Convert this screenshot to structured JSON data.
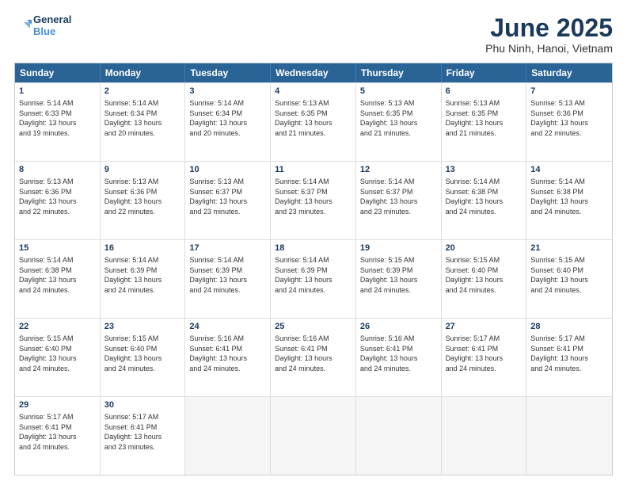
{
  "logo": {
    "line1": "General",
    "line2": "Blue"
  },
  "title": "June 2025",
  "location": "Phu Ninh, Hanoi, Vietnam",
  "headers": [
    "Sunday",
    "Monday",
    "Tuesday",
    "Wednesday",
    "Thursday",
    "Friday",
    "Saturday"
  ],
  "rows": [
    [
      {
        "day": "",
        "info": ""
      },
      {
        "day": "2",
        "info": "Sunrise: 5:14 AM\nSunset: 6:34 PM\nDaylight: 13 hours\nand 20 minutes."
      },
      {
        "day": "3",
        "info": "Sunrise: 5:14 AM\nSunset: 6:34 PM\nDaylight: 13 hours\nand 20 minutes."
      },
      {
        "day": "4",
        "info": "Sunrise: 5:13 AM\nSunset: 6:35 PM\nDaylight: 13 hours\nand 21 minutes."
      },
      {
        "day": "5",
        "info": "Sunrise: 5:13 AM\nSunset: 6:35 PM\nDaylight: 13 hours\nand 21 minutes."
      },
      {
        "day": "6",
        "info": "Sunrise: 5:13 AM\nSunset: 6:35 PM\nDaylight: 13 hours\nand 21 minutes."
      },
      {
        "day": "7",
        "info": "Sunrise: 5:13 AM\nSunset: 6:36 PM\nDaylight: 13 hours\nand 22 minutes."
      }
    ],
    [
      {
        "day": "1",
        "info": "Sunrise: 5:14 AM\nSunset: 6:33 PM\nDaylight: 13 hours\nand 19 minutes."
      },
      null,
      null,
      null,
      null,
      null,
      null
    ],
    [
      {
        "day": "8",
        "info": "Sunrise: 5:13 AM\nSunset: 6:36 PM\nDaylight: 13 hours\nand 22 minutes."
      },
      {
        "day": "9",
        "info": "Sunrise: 5:13 AM\nSunset: 6:36 PM\nDaylight: 13 hours\nand 22 minutes."
      },
      {
        "day": "10",
        "info": "Sunrise: 5:13 AM\nSunset: 6:37 PM\nDaylight: 13 hours\nand 23 minutes."
      },
      {
        "day": "11",
        "info": "Sunrise: 5:14 AM\nSunset: 6:37 PM\nDaylight: 13 hours\nand 23 minutes."
      },
      {
        "day": "12",
        "info": "Sunrise: 5:14 AM\nSunset: 6:37 PM\nDaylight: 13 hours\nand 23 minutes."
      },
      {
        "day": "13",
        "info": "Sunrise: 5:14 AM\nSunset: 6:38 PM\nDaylight: 13 hours\nand 24 minutes."
      },
      {
        "day": "14",
        "info": "Sunrise: 5:14 AM\nSunset: 6:38 PM\nDaylight: 13 hours\nand 24 minutes."
      }
    ],
    [
      {
        "day": "15",
        "info": "Sunrise: 5:14 AM\nSunset: 6:38 PM\nDaylight: 13 hours\nand 24 minutes."
      },
      {
        "day": "16",
        "info": "Sunrise: 5:14 AM\nSunset: 6:39 PM\nDaylight: 13 hours\nand 24 minutes."
      },
      {
        "day": "17",
        "info": "Sunrise: 5:14 AM\nSunset: 6:39 PM\nDaylight: 13 hours\nand 24 minutes."
      },
      {
        "day": "18",
        "info": "Sunrise: 5:14 AM\nSunset: 6:39 PM\nDaylight: 13 hours\nand 24 minutes."
      },
      {
        "day": "19",
        "info": "Sunrise: 5:15 AM\nSunset: 6:39 PM\nDaylight: 13 hours\nand 24 minutes."
      },
      {
        "day": "20",
        "info": "Sunrise: 5:15 AM\nSunset: 6:40 PM\nDaylight: 13 hours\nand 24 minutes."
      },
      {
        "day": "21",
        "info": "Sunrise: 5:15 AM\nSunset: 6:40 PM\nDaylight: 13 hours\nand 24 minutes."
      }
    ],
    [
      {
        "day": "22",
        "info": "Sunrise: 5:15 AM\nSunset: 6:40 PM\nDaylight: 13 hours\nand 24 minutes."
      },
      {
        "day": "23",
        "info": "Sunrise: 5:15 AM\nSunset: 6:40 PM\nDaylight: 13 hours\nand 24 minutes."
      },
      {
        "day": "24",
        "info": "Sunrise: 5:16 AM\nSunset: 6:41 PM\nDaylight: 13 hours\nand 24 minutes."
      },
      {
        "day": "25",
        "info": "Sunrise: 5:16 AM\nSunset: 6:41 PM\nDaylight: 13 hours\nand 24 minutes."
      },
      {
        "day": "26",
        "info": "Sunrise: 5:16 AM\nSunset: 6:41 PM\nDaylight: 13 hours\nand 24 minutes."
      },
      {
        "day": "27",
        "info": "Sunrise: 5:17 AM\nSunset: 6:41 PM\nDaylight: 13 hours\nand 24 minutes."
      },
      {
        "day": "28",
        "info": "Sunrise: 5:17 AM\nSunset: 6:41 PM\nDaylight: 13 hours\nand 24 minutes."
      }
    ],
    [
      {
        "day": "29",
        "info": "Sunrise: 5:17 AM\nSunset: 6:41 PM\nDaylight: 13 hours\nand 24 minutes."
      },
      {
        "day": "30",
        "info": "Sunrise: 5:17 AM\nSunset: 6:41 PM\nDaylight: 13 hours\nand 23 minutes."
      },
      {
        "day": "",
        "info": ""
      },
      {
        "day": "",
        "info": ""
      },
      {
        "day": "",
        "info": ""
      },
      {
        "day": "",
        "info": ""
      },
      {
        "day": "",
        "info": ""
      }
    ]
  ]
}
